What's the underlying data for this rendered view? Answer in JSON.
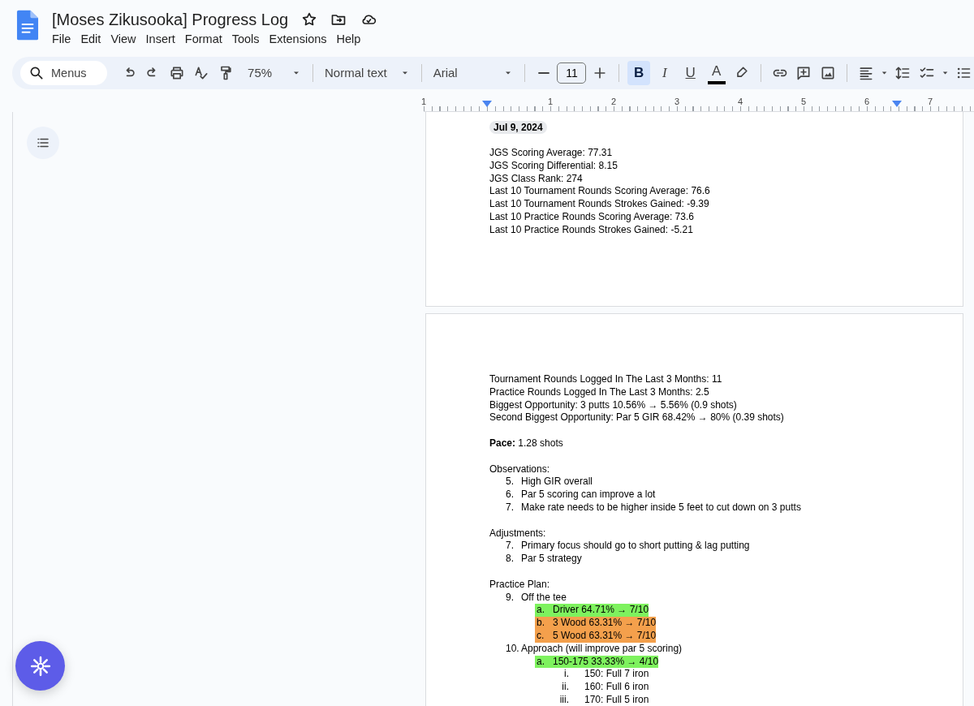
{
  "document": {
    "title": "[Moses Zikusooka] Progress Log"
  },
  "menu_bar": [
    "File",
    "Edit",
    "View",
    "Insert",
    "Format",
    "Tools",
    "Extensions",
    "Help"
  ],
  "toolbar": {
    "search": {
      "placeholder": "Menus"
    },
    "zoom": "75%",
    "paragraph_style": "Normal text",
    "font": "Arial",
    "font_size": "11",
    "format_buttons": [
      {
        "label": "B",
        "kind": "bold",
        "selected": true
      },
      {
        "label": "I",
        "kind": "italic",
        "selected": false
      },
      {
        "label": "U",
        "kind": "underline",
        "selected": false
      },
      {
        "label": "A",
        "kind": "text-color",
        "selected": false
      }
    ]
  },
  "ruler": {
    "labels": [
      "1",
      "1",
      "2",
      "3",
      "4",
      "5",
      "6",
      "7"
    ]
  },
  "pages": [
    {
      "date_chip": "Jul 9, 2024",
      "sections": [
        {
          "lines": [
            "JGS Scoring Average: 77.31",
            "JGS Scoring Differential: 8.15",
            "JGS Class Rank: 274",
            "Last 10 Tournament Rounds Scoring Average: 76.6",
            "Last 10 Tournament Rounds Strokes Gained: -9.39",
            "Last 10 Practice Rounds Scoring Average: 73.6",
            "Last 10 Practice Rounds Strokes Gained: -5.21"
          ]
        }
      ]
    },
    {
      "sections": [
        {
          "lines": [
            "Tournament Rounds Logged In The Last 3 Months: 11",
            "Practice Rounds Logged In The Last 3 Months: 2.5",
            "Biggest Opportunity: 3 putts 10.56% → 5.56% (0.9 shots)",
            "Second Biggest Opportunity: Par 5 GIR 68.42% → 80% (0.39 shots)"
          ]
        },
        {
          "lines": [
            "**Pace:** 1.28 shots"
          ]
        },
        {
          "heading": "Observations:",
          "items": [
            {
              "marker": "5.",
              "text": "High GIR overall"
            },
            {
              "marker": "6.",
              "text": "Par 5 scoring can improve a lot"
            },
            {
              "marker": "7.",
              "text": "Make rate needs to be higher inside 5 feet to cut down on 3 putts"
            }
          ]
        },
        {
          "heading": "Adjustments:",
          "items": [
            {
              "marker": "7.",
              "text": "Primary focus should go to short putting & lag putting"
            },
            {
              "marker": "8.",
              "text": "Par 5 strategy"
            }
          ]
        },
        {
          "heading": "Practice Plan:",
          "items": [
            {
              "marker": "9.",
              "text": "Off the tee",
              "children": [
                {
                  "marker": "a.",
                  "text": "Driver 64.71% → 7/10",
                  "color": "#7ef25e"
                },
                {
                  "marker": "b.",
                  "text": "3 Wood 63.31% → 7/10",
                  "color": "#f4a04c"
                },
                {
                  "marker": "c.",
                  "text": "5 Wood 63.31% → 7/10",
                  "color": "#f4a04c"
                }
              ]
            },
            {
              "marker": "10.",
              "text": "Approach (will improve par 5 scoring)",
              "children": [
                {
                  "marker": "a.",
                  "text": "150-175 33.33% → 4/10",
                  "color": "#7ef25e",
                  "children": [
                    {
                      "marker": "i.",
                      "text": "150: Full 7 iron"
                    },
                    {
                      "marker": "ii.",
                      "text": "160: Full 6 iron"
                    },
                    {
                      "marker": "iii.",
                      "text": "170: Full 5 iron"
                    }
                  ]
                }
              ]
            }
          ]
        }
      ]
    }
  ]
}
